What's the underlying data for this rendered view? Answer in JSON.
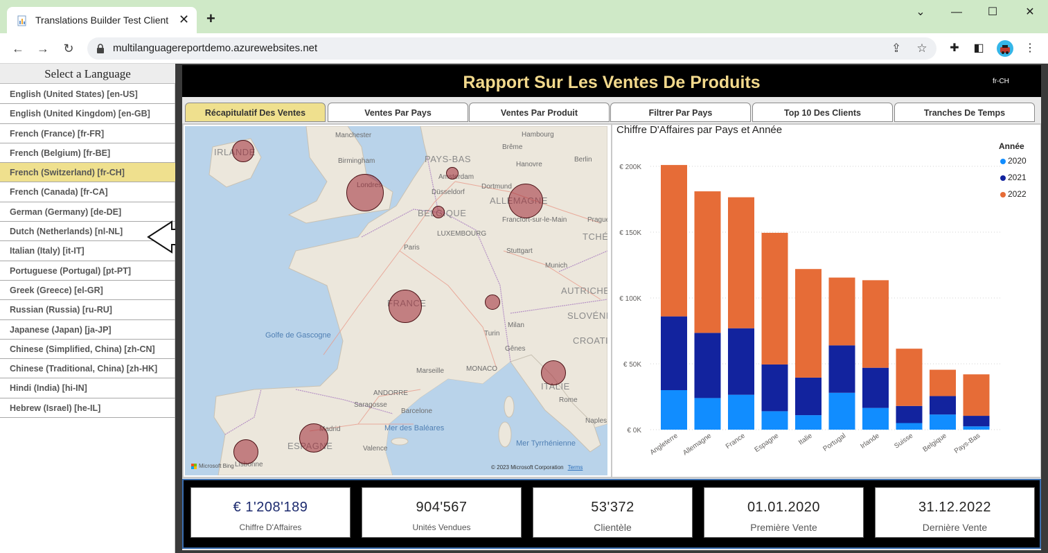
{
  "browser": {
    "tab_title": "Translations Builder Test Client",
    "url": "multilanguagereportdemo.azurewebsites.net"
  },
  "language_panel": {
    "header": "Select a Language",
    "selected_index": 4,
    "items": [
      "English (United States) [en-US]",
      "English (United Kingdom) [en-GB]",
      "French (France) [fr-FR]",
      "French (Belgium) [fr-BE]",
      "French (Switzerland) [fr-CH]",
      "French (Canada) [fr-CA]",
      "German (Germany) [de-DE]",
      "Dutch (Netherlands) [nl-NL]",
      "Italian (Italy) [it-IT]",
      "Portuguese (Portugal) [pt-PT]",
      "Greek (Greece) [el-GR]",
      "Russian (Russia) [ru-RU]",
      "Japanese (Japan) [ja-JP]",
      "Chinese (Simplified, China) [zh-CN]",
      "Chinese (Traditional, China) [zh-HK]",
      "Hindi (India) [hi-IN]",
      "Hebrew (Israel) [he-IL]"
    ]
  },
  "report": {
    "title": "Rapport Sur Les Ventes De Produits",
    "locale": "fr-CH",
    "active_tab_index": 0,
    "tabs": [
      "Récapitulatif Des Ventes",
      "Ventes Par Pays",
      "Ventes Par Produit",
      "Filtrer Par Pays",
      "Top 10 Des Clients",
      "Tranches De Temps"
    ]
  },
  "map": {
    "countries": [
      "IRLANDE",
      "PAYS-BAS",
      "BELGIQUE",
      "ALLEMAGNE",
      "FRANCE",
      "ITALIE",
      "ESPAGNE",
      "AUTRICHE",
      "SLOVÉNIE",
      "CROATIE",
      "TCHÉQ"
    ],
    "cities": [
      "Manchester",
      "Birmingham",
      "Londres",
      "Amsterdam",
      "Düsseldorf",
      "Dortmund",
      "Hanovre",
      "Brême",
      "Hambourg",
      "Berlin",
      "Prague",
      "Francfort-sur-le-Main",
      "LUXEMBOURG",
      "Paris",
      "Stuttgart",
      "Munich",
      "Milan",
      "Turin",
      "Gênes",
      "Marseille",
      "MONACO",
      "ANDORRE",
      "Saragosse",
      "Barcelone",
      "Madrid",
      "Valence",
      "Lisbonne",
      "Rome",
      "Naples"
    ],
    "seas": [
      "Golfe de Gascogne",
      "Mer des Baléares",
      "Mer Tyrrhénienne"
    ],
    "credit": "© 2023 Microsoft Corporation",
    "terms": "Terms",
    "bing": "Microsoft Bing",
    "bubble_countries": [
      "Irlande",
      "Angleterre",
      "Pays-Bas",
      "Belgique",
      "Allemagne",
      "France",
      "Suisse",
      "Italie",
      "Espagne",
      "Portugal"
    ]
  },
  "chart_data": {
    "type": "bar",
    "stacked": true,
    "title": "Chiffre D'Affaires par Pays et Année",
    "legend_title": "Année",
    "legend_position": "top-right",
    "categories": [
      "Angleterre",
      "Allemagne",
      "France",
      "Espagne",
      "Italie",
      "Portugal",
      "Irlande",
      "Suisse",
      "Belgique",
      "Pays-Bas"
    ],
    "series": [
      {
        "name": "2020",
        "color": "#118dff",
        "values": [
          30000,
          24000,
          26500,
          14000,
          11000,
          28000,
          16500,
          5000,
          11500,
          2500
        ]
      },
      {
        "name": "2021",
        "color": "#12239e",
        "values": [
          56000,
          49500,
          50500,
          35500,
          28500,
          36000,
          30500,
          13000,
          14000,
          8000
        ]
      },
      {
        "name": "2022",
        "color": "#e66c37",
        "values": [
          115000,
          107500,
          99500,
          100000,
          82500,
          51500,
          66500,
          43500,
          20000,
          31500
        ]
      }
    ],
    "yticks": [
      "€ 0K",
      "€ 50K",
      "€ 100K",
      "€ 150K",
      "€ 200K"
    ],
    "ylim": [
      0,
      200000
    ],
    "grid": true
  },
  "kpis": [
    {
      "value": "€ 1'208'189",
      "label": "Chiffre D'Affaires"
    },
    {
      "value": "904'567",
      "label": "Unités Vendues"
    },
    {
      "value": "53'372",
      "label": "Clientèle"
    },
    {
      "value": "01.01.2020",
      "label": "Première Vente"
    },
    {
      "value": "31.12.2022",
      "label": "Dernière Vente"
    }
  ],
  "colors": {
    "selected_highlight": "#efe08e",
    "report_title": "#f2d98c",
    "bubble": "#a02a36"
  }
}
